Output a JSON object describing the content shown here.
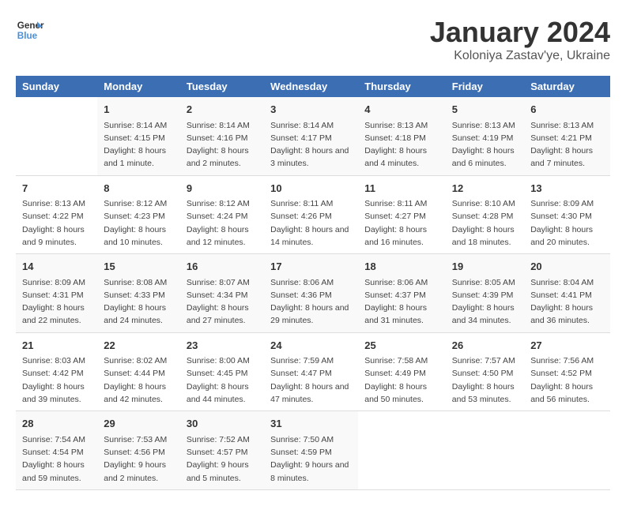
{
  "header": {
    "logo_line1": "General",
    "logo_line2": "Blue",
    "title": "January 2024",
    "subtitle": "Koloniya Zastav'ye, Ukraine"
  },
  "weekdays": [
    "Sunday",
    "Monday",
    "Tuesday",
    "Wednesday",
    "Thursday",
    "Friday",
    "Saturday"
  ],
  "weeks": [
    [
      {
        "day": "",
        "sunrise": "",
        "sunset": "",
        "daylight": ""
      },
      {
        "day": "1",
        "sunrise": "8:14 AM",
        "sunset": "4:15 PM",
        "daylight": "8 hours and 1 minute."
      },
      {
        "day": "2",
        "sunrise": "8:14 AM",
        "sunset": "4:16 PM",
        "daylight": "8 hours and 2 minutes."
      },
      {
        "day": "3",
        "sunrise": "8:14 AM",
        "sunset": "4:17 PM",
        "daylight": "8 hours and 3 minutes."
      },
      {
        "day": "4",
        "sunrise": "8:13 AM",
        "sunset": "4:18 PM",
        "daylight": "8 hours and 4 minutes."
      },
      {
        "day": "5",
        "sunrise": "8:13 AM",
        "sunset": "4:19 PM",
        "daylight": "8 hours and 6 minutes."
      },
      {
        "day": "6",
        "sunrise": "8:13 AM",
        "sunset": "4:21 PM",
        "daylight": "8 hours and 7 minutes."
      }
    ],
    [
      {
        "day": "7",
        "sunrise": "8:13 AM",
        "sunset": "4:22 PM",
        "daylight": "8 hours and 9 minutes."
      },
      {
        "day": "8",
        "sunrise": "8:12 AM",
        "sunset": "4:23 PM",
        "daylight": "8 hours and 10 minutes."
      },
      {
        "day": "9",
        "sunrise": "8:12 AM",
        "sunset": "4:24 PM",
        "daylight": "8 hours and 12 minutes."
      },
      {
        "day": "10",
        "sunrise": "8:11 AM",
        "sunset": "4:26 PM",
        "daylight": "8 hours and 14 minutes."
      },
      {
        "day": "11",
        "sunrise": "8:11 AM",
        "sunset": "4:27 PM",
        "daylight": "8 hours and 16 minutes."
      },
      {
        "day": "12",
        "sunrise": "8:10 AM",
        "sunset": "4:28 PM",
        "daylight": "8 hours and 18 minutes."
      },
      {
        "day": "13",
        "sunrise": "8:09 AM",
        "sunset": "4:30 PM",
        "daylight": "8 hours and 20 minutes."
      }
    ],
    [
      {
        "day": "14",
        "sunrise": "8:09 AM",
        "sunset": "4:31 PM",
        "daylight": "8 hours and 22 minutes."
      },
      {
        "day": "15",
        "sunrise": "8:08 AM",
        "sunset": "4:33 PM",
        "daylight": "8 hours and 24 minutes."
      },
      {
        "day": "16",
        "sunrise": "8:07 AM",
        "sunset": "4:34 PM",
        "daylight": "8 hours and 27 minutes."
      },
      {
        "day": "17",
        "sunrise": "8:06 AM",
        "sunset": "4:36 PM",
        "daylight": "8 hours and 29 minutes."
      },
      {
        "day": "18",
        "sunrise": "8:06 AM",
        "sunset": "4:37 PM",
        "daylight": "8 hours and 31 minutes."
      },
      {
        "day": "19",
        "sunrise": "8:05 AM",
        "sunset": "4:39 PM",
        "daylight": "8 hours and 34 minutes."
      },
      {
        "day": "20",
        "sunrise": "8:04 AM",
        "sunset": "4:41 PM",
        "daylight": "8 hours and 36 minutes."
      }
    ],
    [
      {
        "day": "21",
        "sunrise": "8:03 AM",
        "sunset": "4:42 PM",
        "daylight": "8 hours and 39 minutes."
      },
      {
        "day": "22",
        "sunrise": "8:02 AM",
        "sunset": "4:44 PM",
        "daylight": "8 hours and 42 minutes."
      },
      {
        "day": "23",
        "sunrise": "8:00 AM",
        "sunset": "4:45 PM",
        "daylight": "8 hours and 44 minutes."
      },
      {
        "day": "24",
        "sunrise": "7:59 AM",
        "sunset": "4:47 PM",
        "daylight": "8 hours and 47 minutes."
      },
      {
        "day": "25",
        "sunrise": "7:58 AM",
        "sunset": "4:49 PM",
        "daylight": "8 hours and 50 minutes."
      },
      {
        "day": "26",
        "sunrise": "7:57 AM",
        "sunset": "4:50 PM",
        "daylight": "8 hours and 53 minutes."
      },
      {
        "day": "27",
        "sunrise": "7:56 AM",
        "sunset": "4:52 PM",
        "daylight": "8 hours and 56 minutes."
      }
    ],
    [
      {
        "day": "28",
        "sunrise": "7:54 AM",
        "sunset": "4:54 PM",
        "daylight": "8 hours and 59 minutes."
      },
      {
        "day": "29",
        "sunrise": "7:53 AM",
        "sunset": "4:56 PM",
        "daylight": "9 hours and 2 minutes."
      },
      {
        "day": "30",
        "sunrise": "7:52 AM",
        "sunset": "4:57 PM",
        "daylight": "9 hours and 5 minutes."
      },
      {
        "day": "31",
        "sunrise": "7:50 AM",
        "sunset": "4:59 PM",
        "daylight": "9 hours and 8 minutes."
      },
      {
        "day": "",
        "sunrise": "",
        "sunset": "",
        "daylight": ""
      },
      {
        "day": "",
        "sunrise": "",
        "sunset": "",
        "daylight": ""
      },
      {
        "day": "",
        "sunrise": "",
        "sunset": "",
        "daylight": ""
      }
    ]
  ]
}
